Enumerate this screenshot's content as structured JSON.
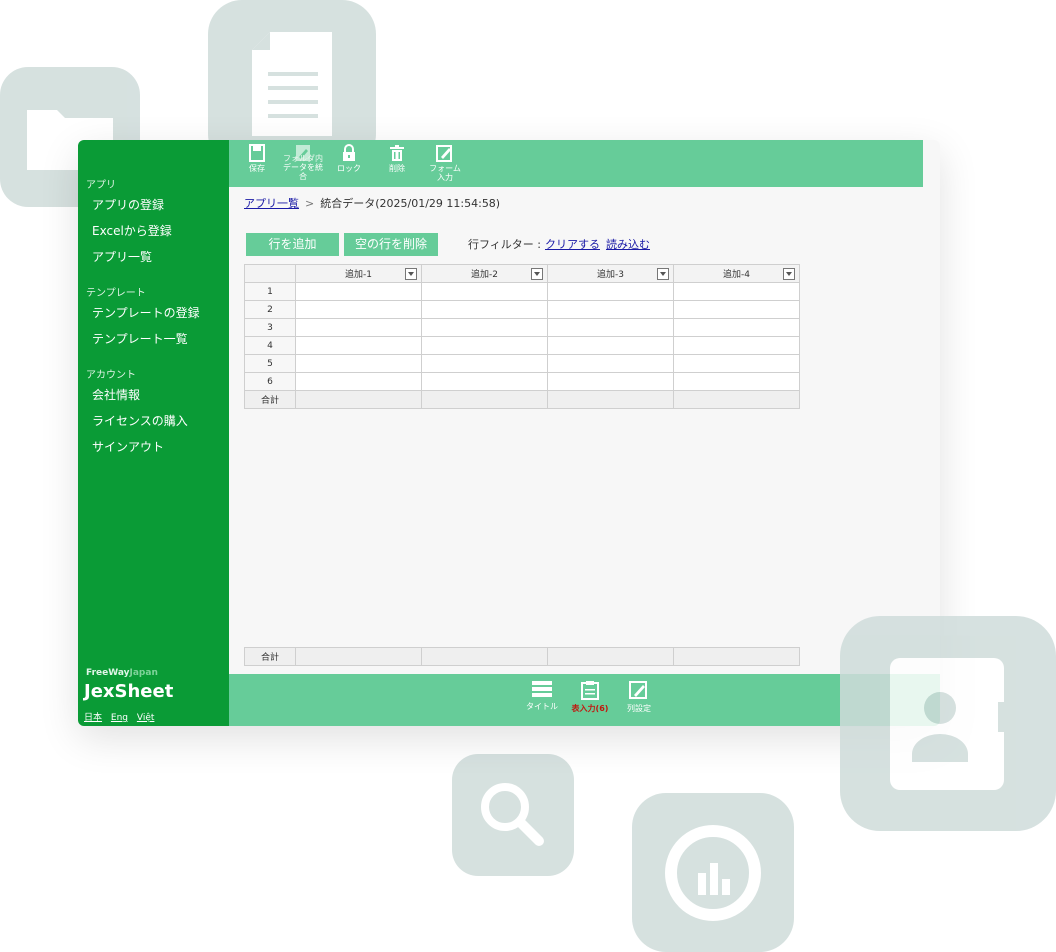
{
  "sidebar": {
    "sections": [
      {
        "title": "アプリ",
        "items": [
          "アプリの登録",
          "Excelから登録",
          "アプリ一覧"
        ]
      },
      {
        "title": "テンプレート",
        "items": [
          "テンプレートの登録",
          "テンプレート一覧"
        ]
      },
      {
        "title": "アカウント",
        "items": [
          "会社情報",
          "ライセンスの購入",
          "サインアウト"
        ]
      }
    ],
    "brand_small_a": "FreeWay",
    "brand_small_b": "Japan",
    "brand": "JexSheet",
    "langs": [
      "日本",
      "Eng",
      "Việt"
    ]
  },
  "toolbar": {
    "save": "保存",
    "merge_line1": "フォルダ内",
    "merge_line2": "データを統",
    "merge_line3": "合",
    "lock": "ロック",
    "delete": "削除",
    "form_line1": "フォーム",
    "form_line2": "入力"
  },
  "breadcrumb": {
    "link": "アプリ一覧",
    "separator": ">",
    "current": "統合データ(2025/01/29 11:54:58)"
  },
  "actions": {
    "add_row": "行を追加",
    "delete_empty_rows": "空の行を削除"
  },
  "filter": {
    "label": "行フィルター :",
    "clear": "クリアする",
    "load": "読み込む"
  },
  "table": {
    "columns": [
      "追加-1",
      "追加-2",
      "追加-3",
      "追加-4"
    ],
    "rows": [
      "1",
      "2",
      "3",
      "4",
      "5",
      "6"
    ],
    "total_label": "合計"
  },
  "bottombar": {
    "title": "タイトル",
    "table_input": "表入力(6)",
    "column_settings": "列設定"
  },
  "colors": {
    "sidebar": "#0a9b36",
    "toolbar": "#66cc99",
    "link": "#1a1aa6",
    "active_tab": "#c0180f",
    "tile": "#cfdcda"
  },
  "icons": [
    "folder-icon",
    "document-icon",
    "search-icon",
    "chart-icon",
    "contact-card-icon"
  ]
}
